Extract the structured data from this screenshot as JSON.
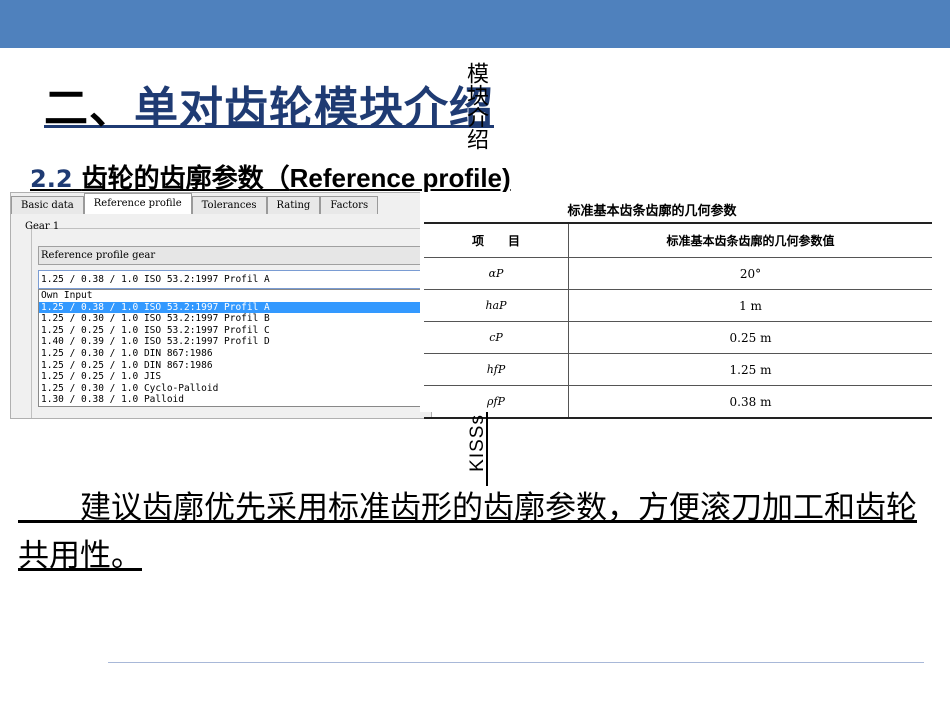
{
  "slide": {
    "title_prefix": "二、",
    "title": "单对齿轮模块介绍",
    "subtitle_num": "2.2",
    "subtitle_cn": "齿轮的齿廓参数（",
    "subtitle_en": "Reference profile)",
    "vertical_text_1": "模块介绍",
    "vertical_text_2": "KISSs",
    "body": "建议齿廓优先采用标准齿形的齿廓参数，方便滚刀加工和齿轮共用性。"
  },
  "panel": {
    "tabs": [
      "Basic data",
      "Reference profile",
      "Tolerances",
      "Rating",
      "Factors"
    ],
    "active_tab": 1,
    "group_label": "Gear 1",
    "field_label": "Reference profile gear",
    "combo_value": "1.25 / 0.38 / 1.0 ISO 53.2:1997 Profil A",
    "options": [
      "Own Input",
      "1.25 / 0.38 / 1.0 ISO 53.2:1997 Profil A",
      "1.25 / 0.30 / 1.0 ISO 53.2:1997 Profil B",
      "1.25 / 0.25 / 1.0 ISO 53.2:1997 Profil C",
      "1.40 / 0.39 / 1.0 ISO 53.2:1997 Profil D",
      "1.25 / 0.30 / 1.0 DIN 867:1986",
      "1.25 / 0.25 / 1.0 DIN 867:1986",
      "1.25 / 0.25 / 1.0 JIS",
      "1.25 / 0.30 / 1.0 Cyclo-Palloid",
      "1.30 / 0.38 / 1.0 Palloid"
    ],
    "selected_option": 1
  },
  "standard_table": {
    "title": "标准基本齿条齿廓的几何参数",
    "headers": [
      "项　　目",
      "标准基本齿条齿廓的几何参数值"
    ],
    "rows": [
      [
        "αP",
        "20°"
      ],
      [
        "haP",
        "1 m"
      ],
      [
        "cP",
        "0.25 m"
      ],
      [
        "hfP",
        "1.25 m"
      ],
      [
        "ρfP",
        "0.38 m"
      ]
    ]
  },
  "colors": {
    "topbar": "#4f81bd",
    "title": "#1f3b73",
    "selection": "#3399ff"
  }
}
